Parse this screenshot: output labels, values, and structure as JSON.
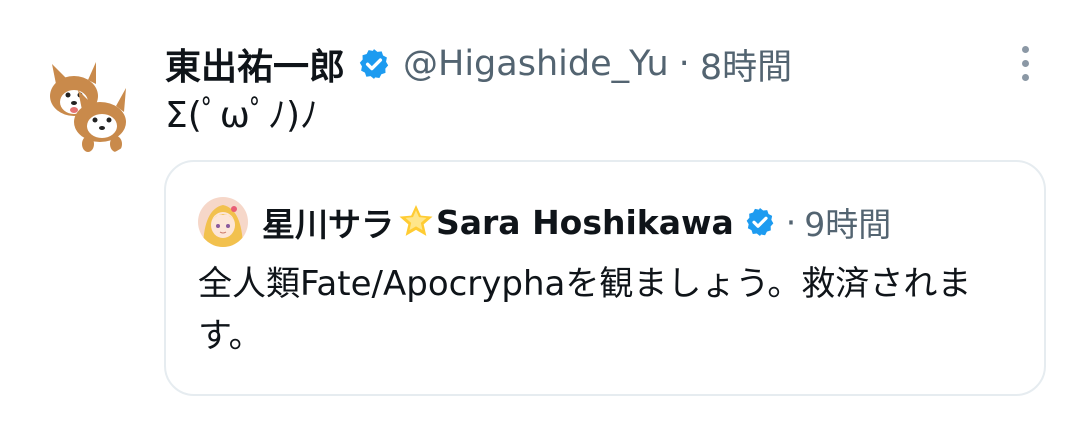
{
  "tweet": {
    "author": {
      "display_name": "東出祐一郎",
      "handle": "@Higashide_Yu",
      "time": "8時間",
      "avatar_icon": "corgi-avatar",
      "verified": true
    },
    "separator": "·",
    "text": "Σ(ﾟωﾟﾉ)ﾉ",
    "more_icon": "more-vertical-icon"
  },
  "quote": {
    "author": {
      "display_name_jp": "星川サラ",
      "emoji": "star-emoji",
      "display_name_en": "Sara Hoshikawa",
      "time": "9時間",
      "verified": true,
      "avatar_icon": "anime-girl-avatar"
    },
    "separator": "·",
    "text": "全人類Fate/Apocryphaを観ましょう。救済されます。"
  },
  "colors": {
    "text": "#0f1419",
    "secondary": "#536471",
    "verified": "#1d9bf0",
    "border": "#e6ecf0"
  }
}
